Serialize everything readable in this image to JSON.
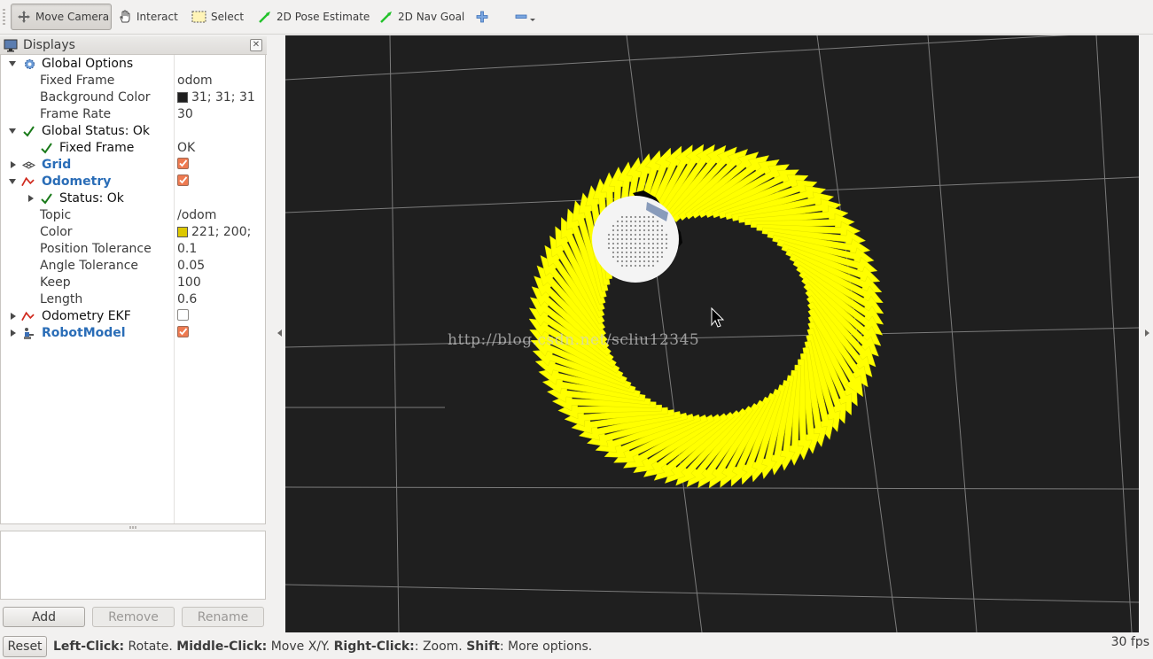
{
  "toolbar": {
    "tools": [
      {
        "label": "Move Camera",
        "icon": "move-camera-icon",
        "active": true
      },
      {
        "label": "Interact",
        "icon": "hand-icon"
      },
      {
        "label": "Select",
        "icon": "select-box-icon"
      },
      {
        "label": "2D Pose Estimate",
        "icon": "green-arrow-icon"
      },
      {
        "label": "2D Nav Goal",
        "icon": "green-arrow-icon"
      }
    ],
    "add_icon": "plus-icon",
    "remove_icon": "minus-icon"
  },
  "displays": {
    "title": "Displays",
    "rows": [
      {
        "label": "Global Options",
        "value": ""
      },
      {
        "label": "Fixed Frame",
        "value": "odom"
      },
      {
        "label": "Background Color",
        "value": "31; 31; 31",
        "swatch": "#1f1f1f"
      },
      {
        "label": "Frame Rate",
        "value": "30"
      },
      {
        "label": "Global Status: Ok",
        "value": ""
      },
      {
        "label": "Fixed Frame",
        "value": "OK"
      },
      {
        "label": "Grid",
        "value": "",
        "checked": true
      },
      {
        "label": "Odometry",
        "value": "",
        "checked": true
      },
      {
        "label": "Status: Ok",
        "value": ""
      },
      {
        "label": "Topic",
        "value": "/odom"
      },
      {
        "label": "Color",
        "value": "221; 200;",
        "swatch": "#ddc800"
      },
      {
        "label": "Position Tolerance",
        "value": "0.1"
      },
      {
        "label": "Angle Tolerance",
        "value": "0.05"
      },
      {
        "label": "Keep",
        "value": "100"
      },
      {
        "label": "Length",
        "value": "0.6"
      },
      {
        "label": "Odometry EKF",
        "value": "",
        "checked": false
      },
      {
        "label": "RobotModel",
        "value": "",
        "checked": true
      }
    ]
  },
  "buttons": {
    "add": "Add",
    "remove": "Remove",
    "rename": "Rename"
  },
  "viewport": {
    "background": "#1f1f1f",
    "arrow_color": "#ffff00",
    "grid_color": "#a0a0a0",
    "watermark": "http://blog.csdn.net/scliu12345"
  },
  "status": {
    "reset": "Reset",
    "left_key": "Left-Click:",
    "left_text": " Rotate. ",
    "middle_key": "Middle-Click:",
    "middle_text": " Move X/Y. ",
    "right_key": "Right-Click:",
    "right_text": ": Zoom. ",
    "shift_key": "Shift",
    "shift_text": ": More options.",
    "fps": "30 fps"
  }
}
